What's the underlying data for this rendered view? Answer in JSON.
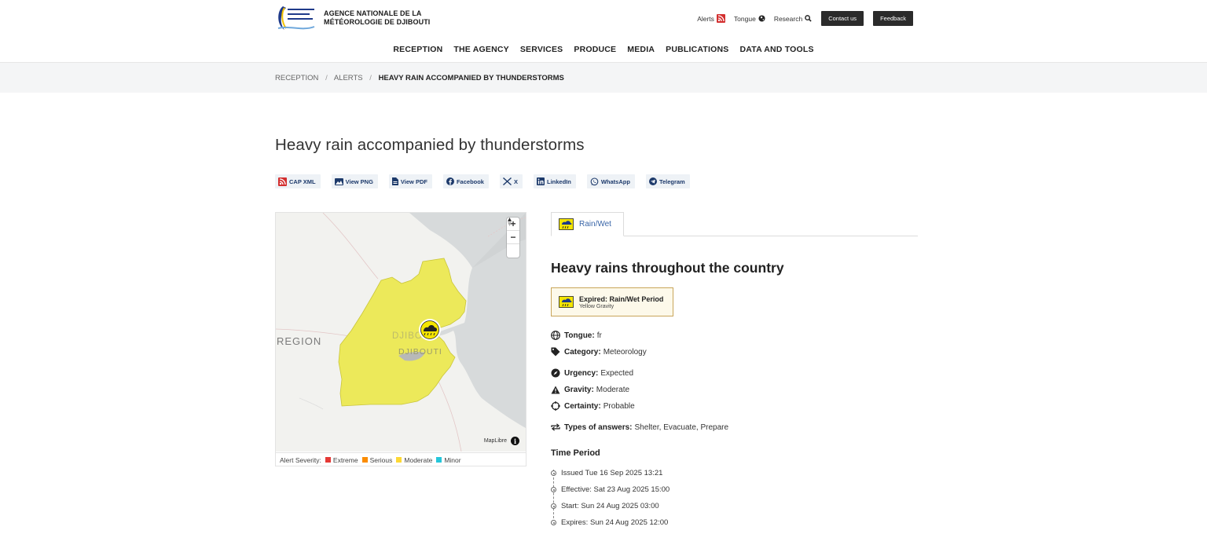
{
  "header": {
    "agency_name_line1": "AGENCE NATIONALE DE LA",
    "agency_name_line2": "MÉTÉOROLOGIE DE DJIBOUTI",
    "top_links": {
      "alerts": "Alerts",
      "tongue": "Tongue",
      "research": "Research",
      "contact": "Contact us",
      "feedback": "Feedback"
    },
    "nav": [
      "RECEPTION",
      "THE AGENCY",
      "SERVICES",
      "PRODUCE",
      "MEDIA",
      "PUBLICATIONS",
      "DATA AND TOOLS"
    ]
  },
  "breadcrumb": {
    "items": [
      "RECEPTION",
      "ALERTS"
    ],
    "current": "HEAVY RAIN ACCOMPANIED BY THUNDERSTORMS"
  },
  "page": {
    "title": "Heavy rain accompanied by thunderstorms"
  },
  "share": [
    {
      "label": "CAP XML",
      "icon": "rss-icon"
    },
    {
      "label": "View PNG",
      "icon": "image-icon"
    },
    {
      "label": "View PDF",
      "icon": "pdf-icon"
    },
    {
      "label": "Facebook",
      "icon": "facebook-icon"
    },
    {
      "label": "X",
      "icon": "x-icon"
    },
    {
      "label": "LinkedIn",
      "icon": "linkedin-icon"
    },
    {
      "label": "WhatsApp",
      "icon": "whatsapp-icon"
    },
    {
      "label": "Telegram",
      "icon": "telegram-icon"
    }
  ],
  "map": {
    "labels": {
      "region": "REGION",
      "city_upper": "DJIBOUTI",
      "city_lower": "DJIBOUTI"
    },
    "attribution": "MapLibre",
    "legend": {
      "title": "Alert Severity:",
      "items": [
        {
          "label": "Extreme",
          "color": "#e53935"
        },
        {
          "label": "Serious",
          "color": "#fb8c00"
        },
        {
          "label": "Moderate",
          "color": "#fdd835"
        },
        {
          "label": "Minor",
          "color": "#26c6da"
        }
      ]
    },
    "area_color": "#ece95a"
  },
  "alert": {
    "tab_label": "Rain/Wet",
    "headline": "Heavy rains throughout the country",
    "status_title": "Expired: Rain/Wet Period",
    "status_subtitle": "Yellow Gravity",
    "details": {
      "tongue": {
        "label": "Tongue:",
        "value": "fr"
      },
      "category": {
        "label": "Category:",
        "value": "Meteorology"
      },
      "urgency": {
        "label": "Urgency:",
        "value": "Expected"
      },
      "gravity": {
        "label": "Gravity:",
        "value": "Moderate"
      },
      "certainty": {
        "label": "Certainty:",
        "value": "Probable"
      },
      "responses": {
        "label": "Types of answers:",
        "value": "Shelter, Evacuate, Prepare"
      }
    },
    "time_period": {
      "title": "Time Period",
      "items": [
        "Issued Tue 16 Sep 2025 13:21",
        "Effective: Sat 23 Aug 2025 15:00",
        "Start: Sun 24 Aug 2025 03:00",
        "Expires: Sun 24 Aug 2025 12:00"
      ]
    }
  }
}
